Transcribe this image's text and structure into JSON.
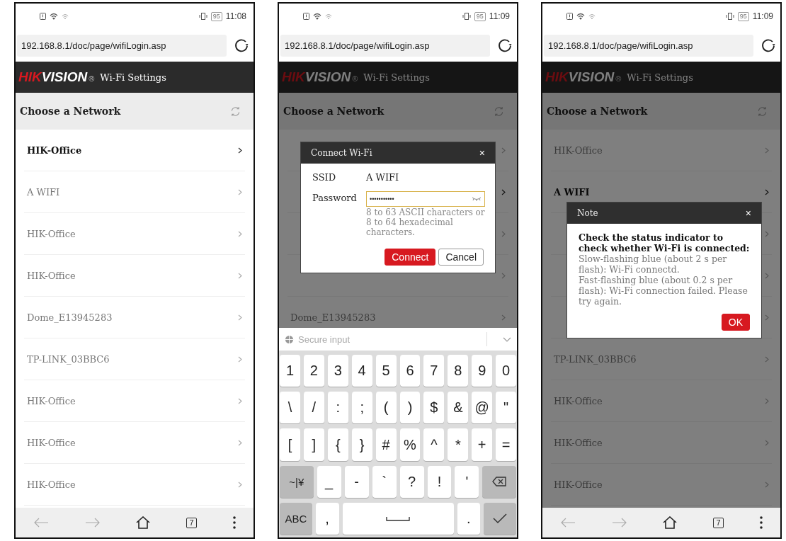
{
  "phones": [
    {
      "status_bar": {
        "battery": "95",
        "time": "11:08"
      },
      "address_bar": {
        "url": "192.168.8.1/doc/page/wifiLogin.asp"
      },
      "header": {
        "logo": {
          "accent": "HIK",
          "rest": "VISION",
          "mark": "®"
        },
        "title": "Wi-Fi Settings"
      },
      "section": {
        "title": "Choose a Network"
      },
      "networks": [
        {
          "label": "HIK-Office",
          "selected": true
        },
        {
          "label": "A WIFI",
          "selected": false
        },
        {
          "label": "HIK-Office",
          "selected": false
        },
        {
          "label": "HIK-Office",
          "selected": false
        },
        {
          "label": "Dome_E13945283",
          "selected": false
        },
        {
          "label": "TP-LINK_03BBC6",
          "selected": false
        },
        {
          "label": "HIK-Office",
          "selected": false
        },
        {
          "label": "HIK-Office",
          "selected": false
        },
        {
          "label": "HIK-Office",
          "selected": false
        }
      ],
      "bottom_nav": {
        "tabs_count": "7"
      }
    },
    {
      "status_bar": {
        "battery": "95",
        "time": "11:09"
      },
      "address_bar": {
        "url": "192.168.8.1/doc/page/wifiLogin.asp"
      },
      "header": {
        "logo": {
          "accent": "HIK",
          "rest": "VISION",
          "mark": "®"
        },
        "title": "Wi-Fi Settings"
      },
      "section": {
        "title": "Choose a Network"
      },
      "networks": [
        {
          "selected": false
        },
        {
          "selected": true
        },
        {
          "selected": false
        },
        {
          "selected": false
        },
        {
          "label": "Dome_E13945283",
          "selected": false
        }
      ],
      "dialog": {
        "kind": "connect",
        "title": "Connect Wi-Fi",
        "close": "×",
        "ssid": {
          "label": "SSID",
          "value": "A WIFI"
        },
        "password": {
          "label": "Password",
          "value": "•••••••••••",
          "hint": "8 to 63 ASCII characters or 8 to 64 hexadecimal characters."
        },
        "buttons": [
          {
            "label": "Connect",
            "primary": true
          },
          {
            "label": "Cancel",
            "primary": false
          }
        ]
      },
      "keyboard": {
        "placeholder": "Secure input",
        "number_row": [
          {
            "kind": "char",
            "label": "1"
          },
          {
            "kind": "char",
            "label": "2"
          },
          {
            "kind": "char",
            "label": "3"
          },
          {
            "kind": "char",
            "label": "4"
          },
          {
            "kind": "char",
            "label": "5"
          },
          {
            "kind": "char",
            "label": "6"
          },
          {
            "kind": "char",
            "label": "7"
          },
          {
            "kind": "char",
            "label": "8"
          },
          {
            "kind": "char",
            "label": "9"
          },
          {
            "kind": "char",
            "label": "0"
          }
        ],
        "symbol_row": [
          {
            "kind": "char",
            "label": "\\"
          },
          {
            "kind": "char",
            "label": "/"
          },
          {
            "kind": "char",
            "label": ":"
          },
          {
            "kind": "char",
            "label": ";"
          },
          {
            "kind": "char",
            "label": "("
          },
          {
            "kind": "char",
            "label": ")"
          },
          {
            "kind": "char",
            "label": "$"
          },
          {
            "kind": "char",
            "label": "&"
          },
          {
            "kind": "char",
            "label": "@"
          },
          {
            "kind": "char",
            "label": "\""
          }
        ],
        "bracket_row": [
          {
            "kind": "char",
            "label": "["
          },
          {
            "kind": "char",
            "label": "]"
          },
          {
            "kind": "char",
            "label": "{"
          },
          {
            "kind": "char",
            "label": "}"
          },
          {
            "kind": "char",
            "label": "#"
          },
          {
            "kind": "char",
            "label": "%"
          },
          {
            "kind": "char",
            "label": "^"
          },
          {
            "kind": "char",
            "label": "*"
          },
          {
            "kind": "char",
            "label": "+"
          },
          {
            "kind": "char",
            "label": "="
          }
        ],
        "punctuation_row": [
          {
            "kind": "function",
            "label": "~|¥"
          },
          {
            "kind": "char",
            "label": "_"
          },
          {
            "kind": "char",
            "label": "-"
          },
          {
            "kind": "char",
            "label": "`"
          },
          {
            "kind": "char",
            "label": "?"
          },
          {
            "kind": "char",
            "label": "!"
          },
          {
            "kind": "char",
            "label": "'"
          },
          {
            "kind": "backspace"
          }
        ],
        "bottom_row": [
          {
            "kind": "function",
            "label": "ABC"
          },
          {
            "kind": "char",
            "label": ","
          },
          {
            "kind": "space"
          },
          {
            "kind": "char",
            "label": "."
          },
          {
            "kind": "enter"
          }
        ]
      }
    },
    {
      "status_bar": {
        "battery": "95",
        "time": "11:09"
      },
      "address_bar": {
        "url": "192.168.8.1/doc/page/wifiLogin.asp"
      },
      "header": {
        "logo": {
          "accent": "HIK",
          "rest": "VISION",
          "mark": "®"
        },
        "title": "Wi-Fi Settings"
      },
      "section": {
        "title": "Choose a Network"
      },
      "networks": [
        {
          "label": "HIK-Office",
          "selected": false
        },
        {
          "label": "A WIFI",
          "selected": true
        },
        {
          "selected": false
        },
        {
          "selected": false
        },
        {
          "selected": false
        },
        {
          "label": "TP-LINK_03BBC6",
          "selected": false
        },
        {
          "label": "HIK-Office",
          "selected": false
        },
        {
          "label": "HIK-Office",
          "selected": false
        },
        {
          "label": "HIK-Office",
          "selected": false
        }
      ],
      "dialog": {
        "kind": "note",
        "title": "Note",
        "close": "×",
        "heading": "Check the status indicator to check whether Wi-Fi is connected:",
        "lines": [
          "Slow-flashing blue (about 2 s per flash): Wi-Fi connectd.",
          "Fast-flashing blue (about 0.2 s per flash): Wi-Fi connection failed. Please try again."
        ],
        "buttons": [
          {
            "label": "OK",
            "primary": true
          }
        ]
      },
      "bottom_nav": {
        "tabs_count": "7"
      }
    }
  ]
}
